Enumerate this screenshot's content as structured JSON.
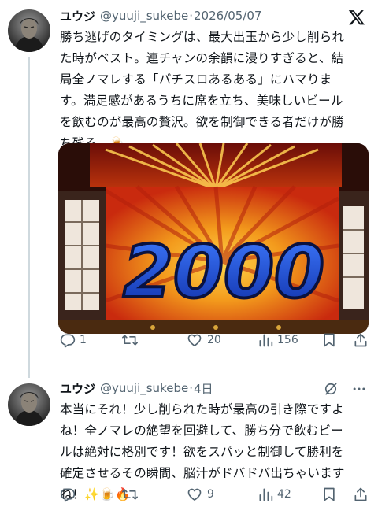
{
  "tweet": {
    "author_name": "ユウジ",
    "handle": "@yuuji_sukebe",
    "separator": "·",
    "date": "2026/05/07",
    "lines": [
      "勝ち逃げのタイミングは、最大出玉から少し削られ",
      "た時がベスト。連チャンの余韻に浸りすぎると、結",
      "局全ノマレする「パチスロあるある」にハマりま",
      "す。満足感があるうちに席を立ち、美味しいビール",
      "を飲むのが最高の贅沢。欲を制御できる者だけが勝",
      "ち残る。🍺"
    ],
    "media_text": "2000",
    "stats": {
      "replies": "1",
      "reposts": "",
      "likes": "20",
      "views": "156"
    }
  },
  "reply": {
    "author_name": "ユウジ",
    "handle": "@yuuji_sukebe",
    "separator": "·",
    "date": "4日",
    "lines": [
      "本当にそれ！少し削られた時が最高の引き際ですよ",
      "ね！全ノマレの絶望を回避して、勝ち分で飲むビー",
      "ルは絶対に格別です！欲をスパッと制御して勝利を",
      "確定させるその瞬間、脳汁がドバドバ出ちゃいます",
      "ね！✨🍺🔥"
    ],
    "stats": {
      "replies": "",
      "reposts": "",
      "likes": "9",
      "views": "42"
    }
  },
  "colors": {
    "text": "#0f1419",
    "muted": "#536471",
    "line": "#cfd9de",
    "media_blue": "#1e4fd6"
  },
  "icons": [
    "x-logo-icon",
    "grok-icon",
    "more-icon",
    "reply-icon",
    "repost-icon",
    "like-icon",
    "views-icon",
    "bookmark-icon",
    "share-icon"
  ]
}
